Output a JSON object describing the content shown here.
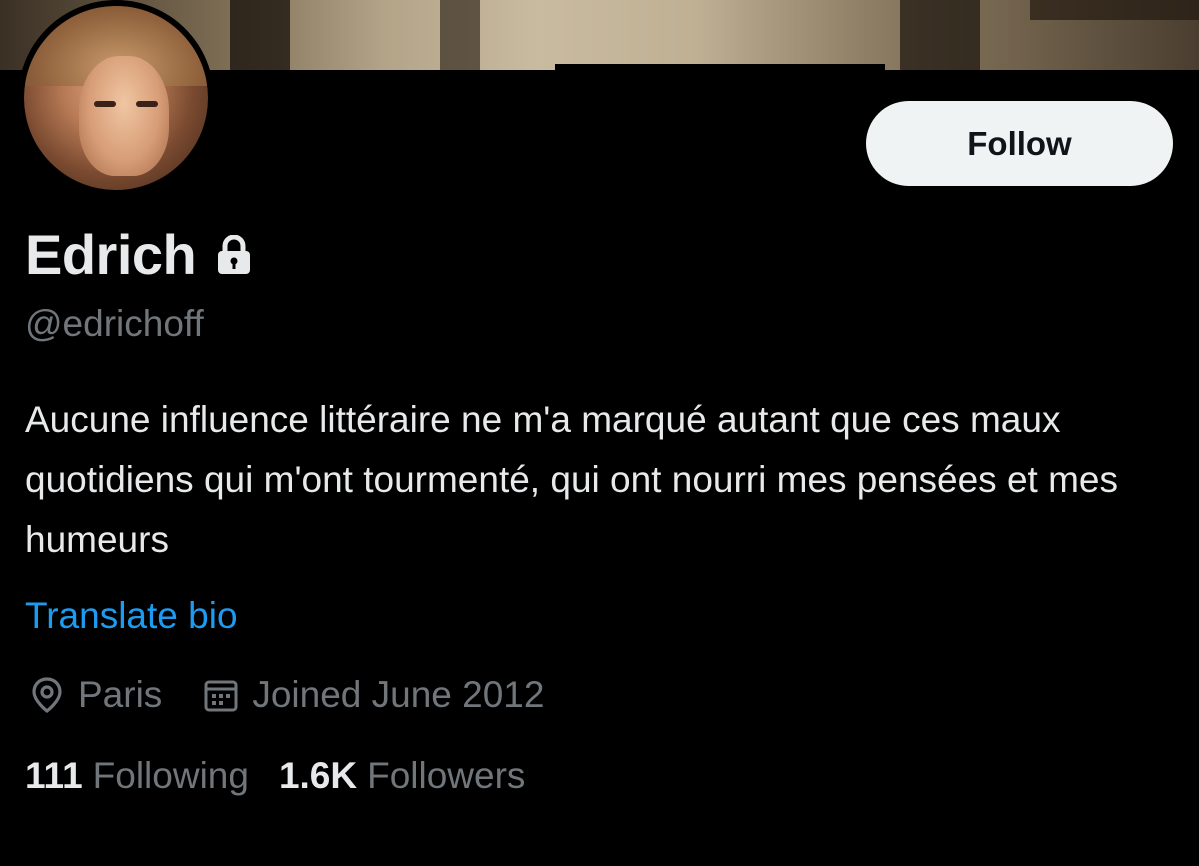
{
  "profile": {
    "display_name": "Edrich",
    "handle": "@edrichoff",
    "protected_icon": "lock-icon",
    "bio": "Aucune influence littéraire ne m'a marqué autant que ces maux quotidiens qui m'ont tourmenté, qui ont nourri mes pensées et mes humeurs",
    "translate_label": "Translate bio",
    "location": "Paris",
    "location_icon": "location-pin-icon",
    "joined": "Joined June 2012",
    "joined_icon": "calendar-icon",
    "following_count": "111",
    "following_label": "Following",
    "followers_count": "1.6K",
    "followers_label": "Followers"
  },
  "actions": {
    "follow_label": "Follow"
  },
  "colors": {
    "background": "#000000",
    "primary_text": "#e7e9ea",
    "secondary_text": "#71767b",
    "link": "#1d9bf0",
    "button_bg": "#eff3f4",
    "button_text": "#0f1419"
  }
}
